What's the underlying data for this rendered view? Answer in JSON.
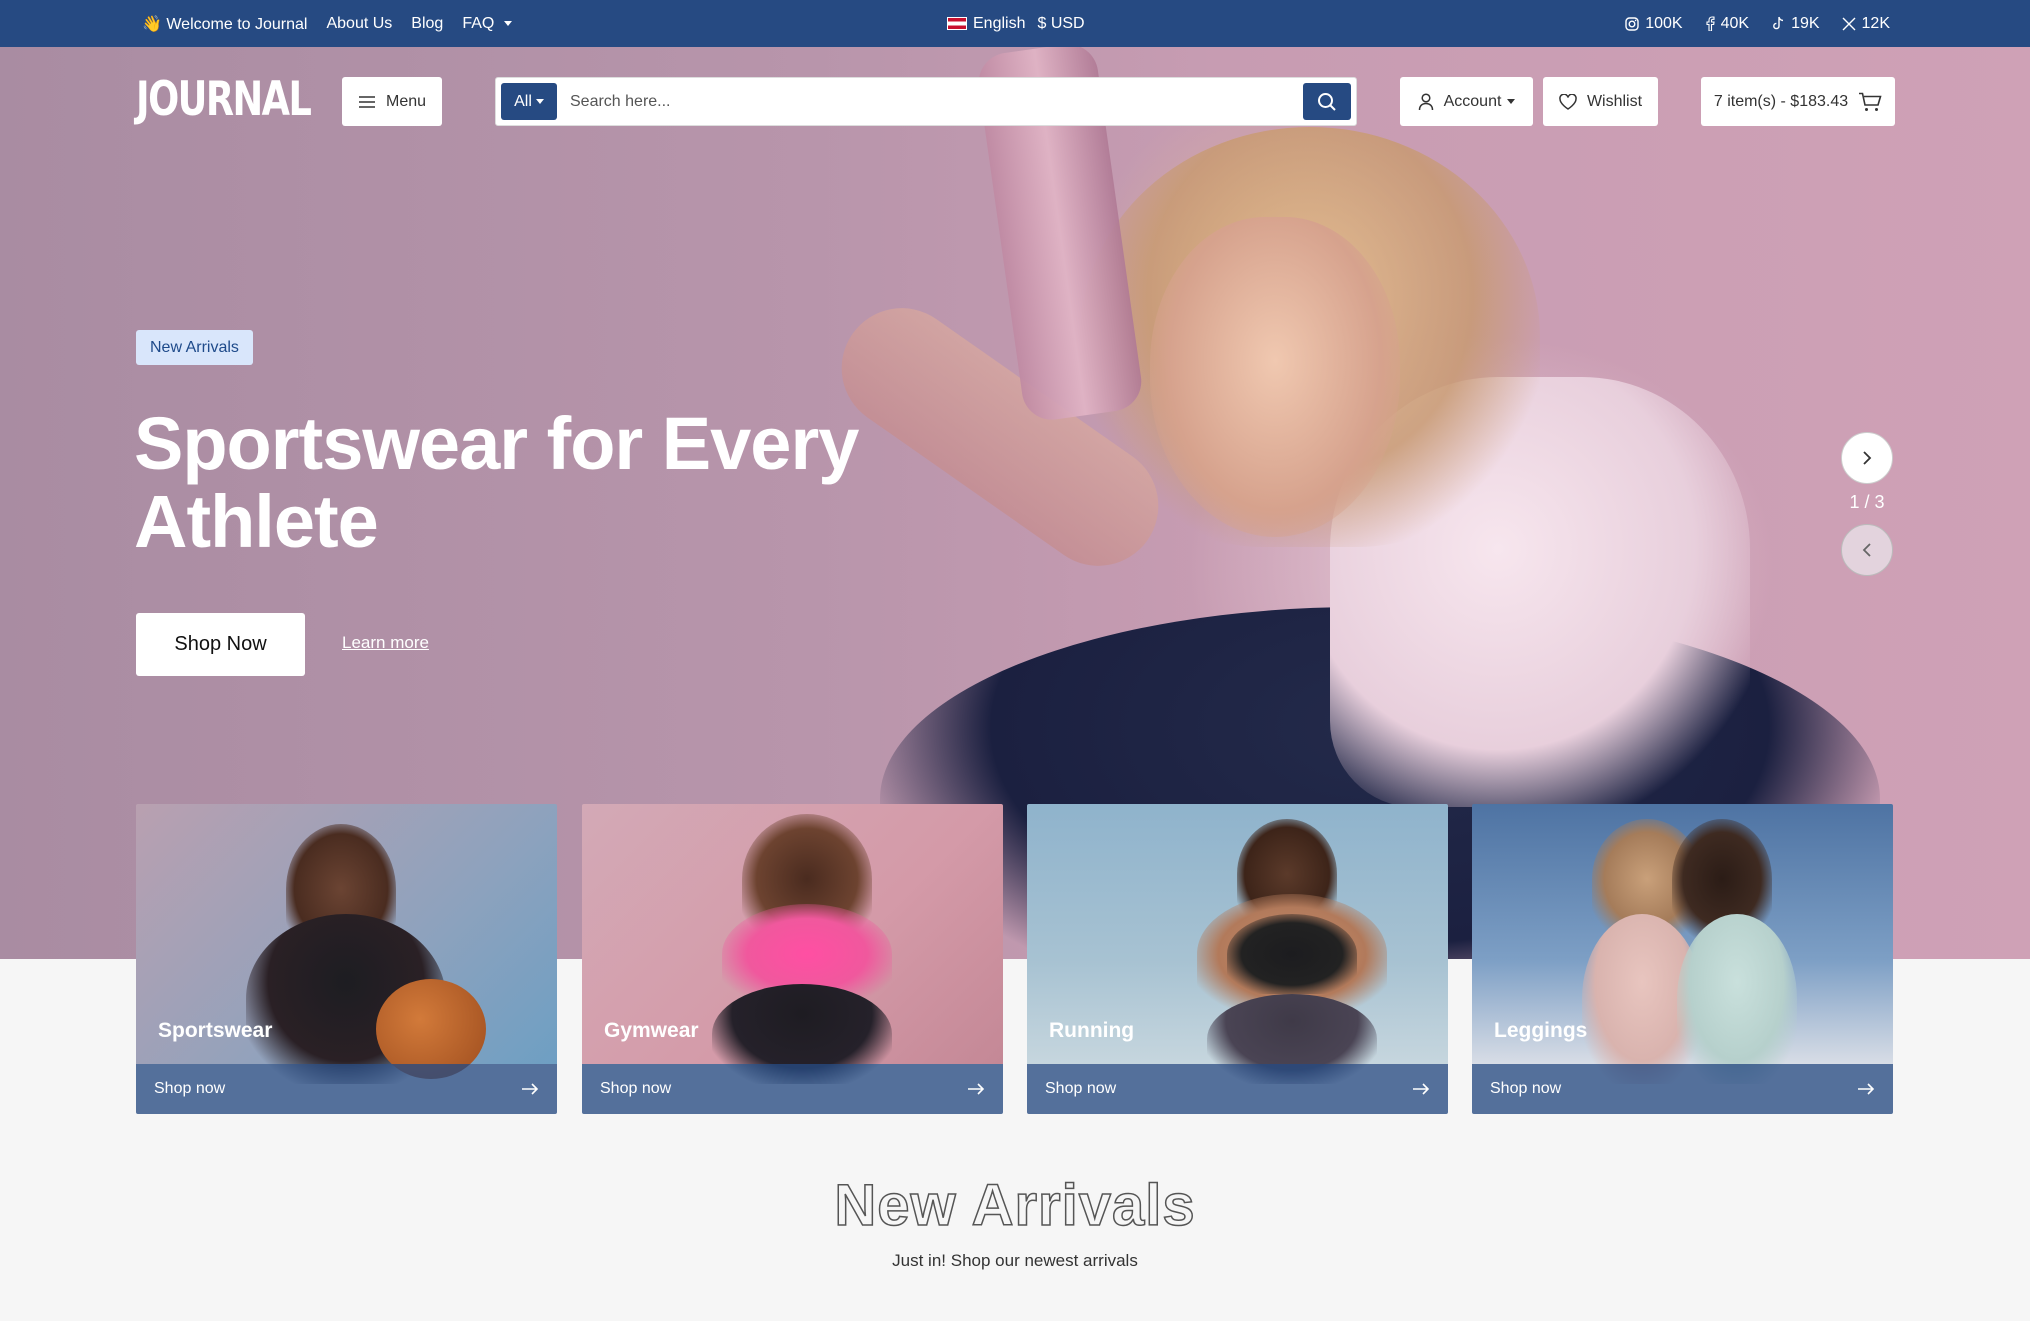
{
  "topbar": {
    "welcome": "👋 Welcome to Journal",
    "links": [
      "About Us",
      "Blog",
      "FAQ"
    ],
    "language": "English",
    "currency": "$ USD",
    "social": [
      {
        "icon": "instagram-icon",
        "count": "100K"
      },
      {
        "icon": "facebook-icon",
        "count": "40K"
      },
      {
        "icon": "tiktok-icon",
        "count": "19K"
      },
      {
        "icon": "x-icon",
        "count": "12K"
      }
    ]
  },
  "header": {
    "logo": "JOURNAL",
    "menu_label": "Menu",
    "search": {
      "category": "All",
      "placeholder": "Search here..."
    },
    "account_label": "Account",
    "wishlist_label": "Wishlist",
    "cart_label": "7 item(s) - $183.43"
  },
  "hero": {
    "badge": "New Arrivals",
    "title": "Sportswear for Every Athlete",
    "primary_cta": "Shop Now",
    "secondary_cta": "Learn more",
    "slide_counter": "1 / 3"
  },
  "categories": [
    {
      "name": "Sportswear",
      "cta": "Shop now"
    },
    {
      "name": "Gymwear",
      "cta": "Shop now"
    },
    {
      "name": "Running",
      "cta": "Shop now"
    },
    {
      "name": "Leggings",
      "cta": "Shop now"
    }
  ],
  "new_arrivals": {
    "title": "New Arrivals",
    "subtitle": "Just in! Shop our newest arrivals"
  },
  "colors": {
    "brand": "#264a82",
    "badge_bg": "#d9e6fb",
    "badge_text": "#1e4a8a"
  }
}
